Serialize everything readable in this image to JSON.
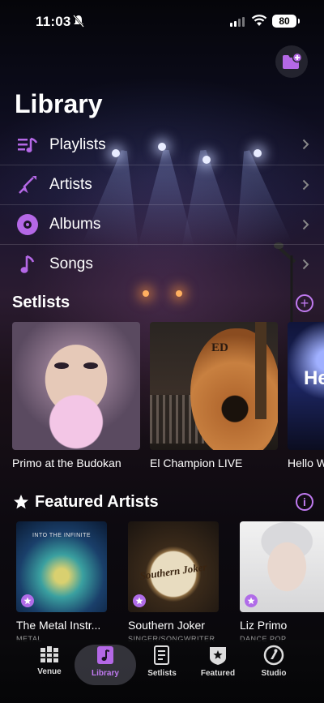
{
  "status": {
    "time": "11:03",
    "battery": "80"
  },
  "page_title": "Library",
  "library_items": [
    {
      "label": "Playlists",
      "icon": "playlist-icon"
    },
    {
      "label": "Artists",
      "icon": "guitar-icon"
    },
    {
      "label": "Albums",
      "icon": "album-icon"
    },
    {
      "label": "Songs",
      "icon": "music-note-icon"
    }
  ],
  "setlists": {
    "title": "Setlists",
    "items": [
      {
        "title": "Primo at the Budokan"
      },
      {
        "title": "El Champion LIVE",
        "art_text": "ED"
      },
      {
        "title": "Hello W",
        "art_text": "He"
      }
    ]
  },
  "featured": {
    "title": "Featured Artists",
    "items": [
      {
        "name": "The Metal Instr...",
        "genre": "METAL",
        "art_text": "INTO THE INFINITE"
      },
      {
        "name": "Southern Joker",
        "genre": "SINGER/SONGWRITER",
        "art_text": "Southern Joker"
      },
      {
        "name": "Liz Primo",
        "genre": "DANCE POP"
      }
    ]
  },
  "tabs": [
    {
      "label": "Venue",
      "icon": "venue-icon"
    },
    {
      "label": "Library",
      "icon": "library-icon",
      "active": true
    },
    {
      "label": "Setlists",
      "icon": "setlist-icon"
    },
    {
      "label": "Featured",
      "icon": "featured-icon"
    },
    {
      "label": "Studio",
      "icon": "studio-icon"
    }
  ],
  "colors": {
    "accent": "#c07af0",
    "background": "#0a0810"
  }
}
